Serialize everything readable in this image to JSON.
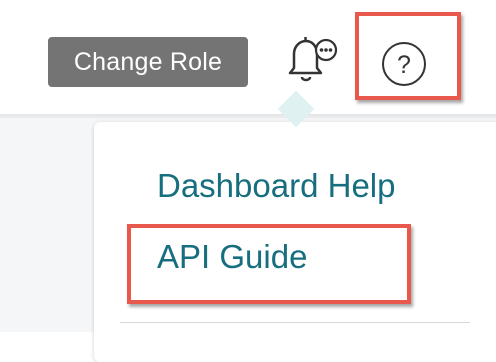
{
  "header": {
    "change_role_label": "Change Role",
    "notification_icon": "bell-chat-icon",
    "help_icon": "question-mark-circle-icon",
    "help_symbol": "?"
  },
  "help_menu": {
    "items": [
      {
        "label": "Dashboard Help"
      },
      {
        "label": "API Guide"
      }
    ]
  },
  "colors": {
    "highlight": "#e8584c",
    "menu_text": "#166e7e",
    "change_role_bg": "#747474"
  }
}
